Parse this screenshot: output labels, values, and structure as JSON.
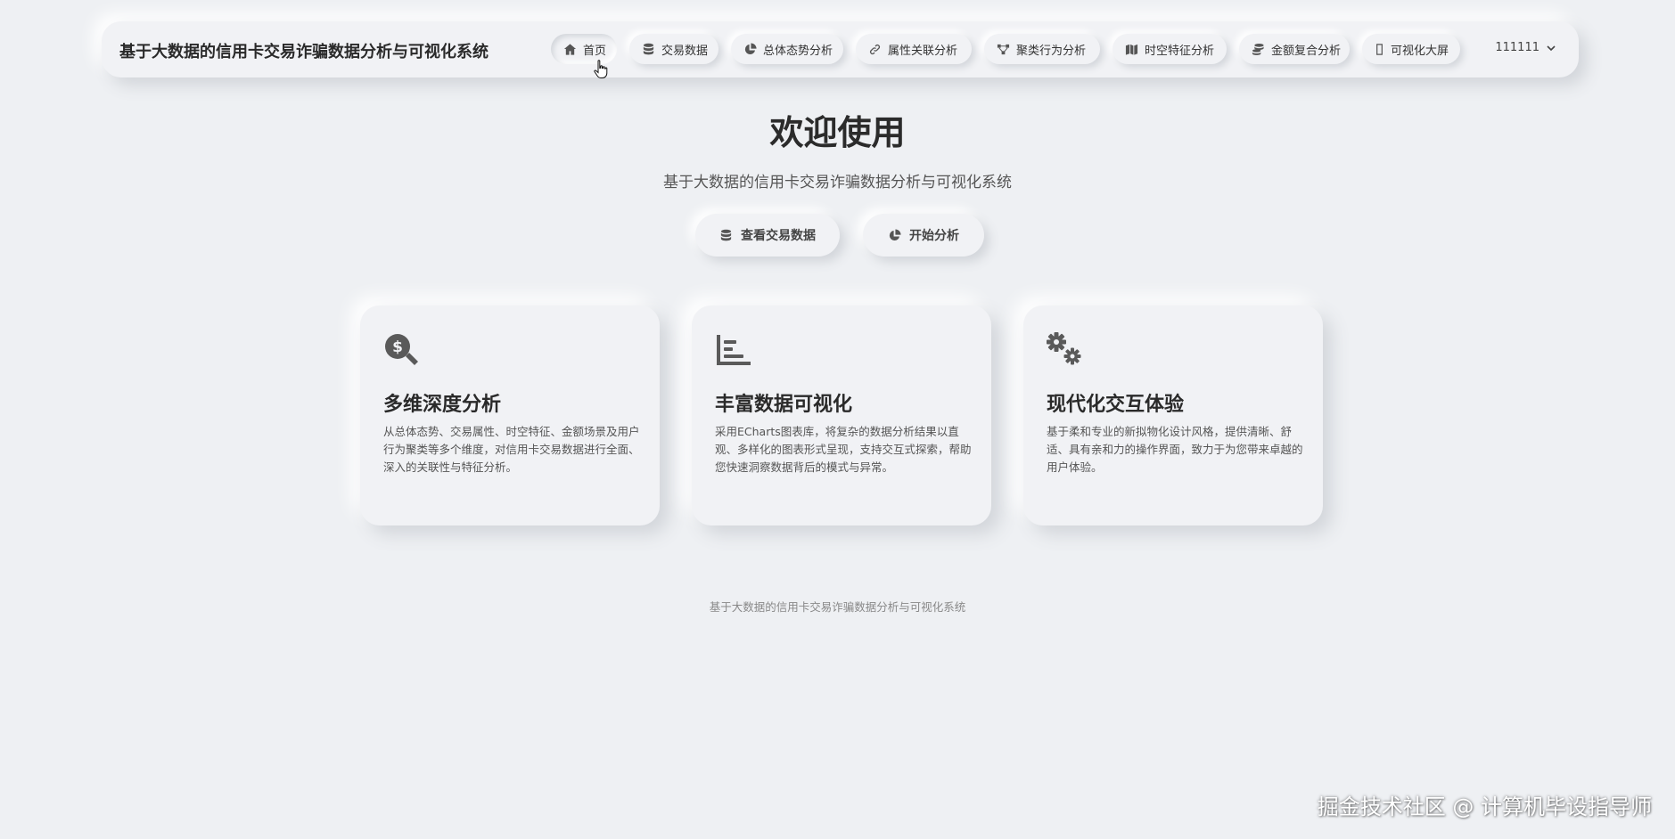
{
  "header": {
    "brand": "基于大数据的信用卡交易诈骗数据分析与可视化系统",
    "nav": [
      {
        "label": "首页",
        "icon": "home-icon",
        "active": true
      },
      {
        "label": "交易数据",
        "icon": "database-icon"
      },
      {
        "label": "总体态势分析",
        "icon": "pie-chart-icon"
      },
      {
        "label": "属性关联分析",
        "icon": "link-icon"
      },
      {
        "label": "聚类行为分析",
        "icon": "cluster-icon"
      },
      {
        "label": "时空特征分析",
        "icon": "map-icon"
      },
      {
        "label": "金额复合分析",
        "icon": "coins-icon"
      },
      {
        "label": "可视化大屏",
        "icon": "screen-icon"
      }
    ],
    "user": "111111"
  },
  "hero": {
    "title": "欢迎使用",
    "subtitle": "基于大数据的信用卡交易诈骗数据分析与可视化系统",
    "buttons": [
      {
        "label": "查看交易数据",
        "icon": "database-icon"
      },
      {
        "label": "开始分析",
        "icon": "pie-chart-icon"
      }
    ]
  },
  "cards": [
    {
      "icon": "search-dollar-icon",
      "title": "多维深度分析",
      "desc": "从总体态势、交易属性、时空特征、金额场景及用户行为聚类等多个维度，对信用卡交易数据进行全面、深入的关联性与特征分析。"
    },
    {
      "icon": "bar-chart-icon",
      "title": "丰富数据可视化",
      "desc": "采用ECharts图表库，将复杂的数据分析结果以直观、多样化的图表形式呈现，支持交互式探索，帮助您快速洞察数据背后的模式与异常。"
    },
    {
      "icon": "gears-icon",
      "title": "现代化交互体验",
      "desc": "基于柔和专业的新拟物化设计风格，提供清晰、舒适、具有亲和力的操作界面，致力于为您带来卓越的用户体验。"
    }
  ],
  "footer": "基于大数据的信用卡交易诈骗数据分析与可视化系统",
  "watermark": "掘金技术社区 @ 计算机毕设指导师"
}
